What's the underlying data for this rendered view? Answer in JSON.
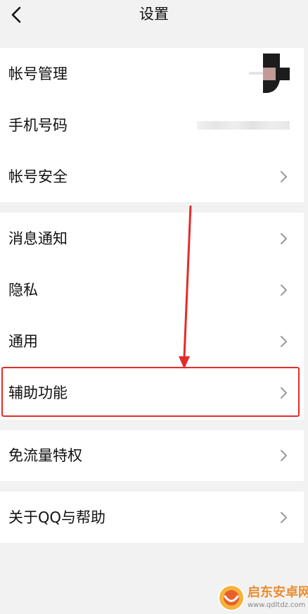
{
  "header": {
    "title": "设置"
  },
  "groups": [
    {
      "items": [
        {
          "label": "帐号管理",
          "trailing": "avatar"
        },
        {
          "label": "手机号码",
          "trailing": "masked-phone"
        },
        {
          "label": "帐号安全",
          "trailing": "chevron"
        }
      ]
    },
    {
      "items": [
        {
          "label": "消息通知",
          "trailing": "chevron"
        },
        {
          "label": "隐私",
          "trailing": "chevron"
        },
        {
          "label": "通用",
          "trailing": "chevron"
        },
        {
          "label": "辅助功能",
          "trailing": "chevron",
          "highlighted": true
        }
      ]
    },
    {
      "items": [
        {
          "label": "免流量特权",
          "trailing": "chevron"
        }
      ]
    },
    {
      "items": [
        {
          "label": "关于QQ与帮助",
          "trailing": "chevron"
        }
      ]
    }
  ],
  "watermark": {
    "title": "启东安卓网",
    "url": "www.qdltdz.com"
  },
  "colors": {
    "background": "#f2f2f2",
    "card": "#ffffff",
    "text": "#111111",
    "chevron": "#9a9a9a",
    "highlight": "#e32b2b",
    "watermark": "#e98a2e"
  },
  "icons": {
    "back": "chevron-left-icon",
    "row": "chevron-right-icon"
  }
}
